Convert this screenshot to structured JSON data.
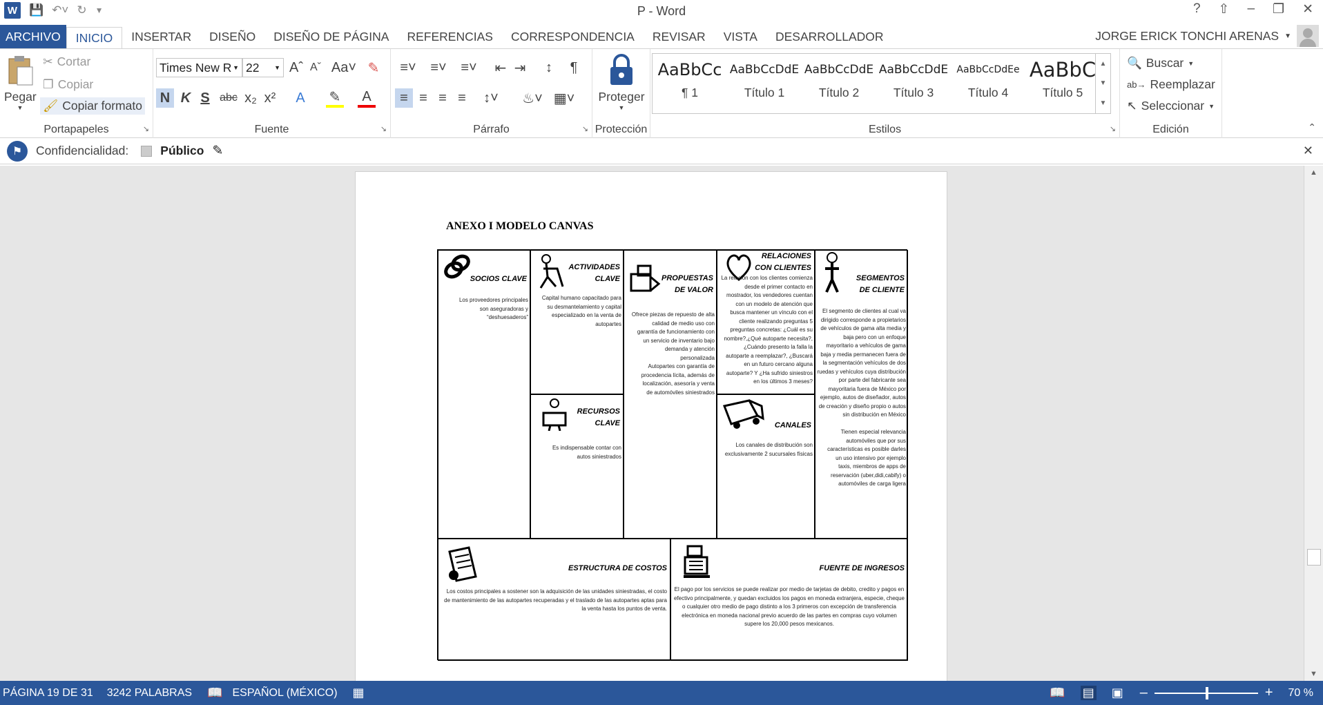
{
  "window": {
    "title": "P - Word"
  },
  "tabs": [
    {
      "label": "ARCHIVO"
    },
    {
      "label": "INICIO"
    },
    {
      "label": "INSERTAR"
    },
    {
      "label": "DISEÑO"
    },
    {
      "label": "DISEÑO DE PÁGINA"
    },
    {
      "label": "REFERENCIAS"
    },
    {
      "label": "CORRESPONDENCIA"
    },
    {
      "label": "REVISAR"
    },
    {
      "label": "VISTA"
    },
    {
      "label": "DESARROLLADOR"
    }
  ],
  "user": {
    "name": "JORGE ERICK TONCHI ARENAS"
  },
  "ribbon": {
    "clipboard": {
      "paste": "Pegar",
      "cut": "Cortar",
      "copy": "Copiar",
      "format_painter": "Copiar formato",
      "label": "Portapapeles"
    },
    "font": {
      "name": "Times New R",
      "size": "22",
      "label": "Fuente",
      "bold": "N",
      "italic": "K",
      "underline": "S",
      "strike": "abc"
    },
    "paragraph": {
      "label": "Párrafo"
    },
    "protection": {
      "protect": "Proteger",
      "label": "Protección"
    },
    "styles": {
      "label": "Estilos",
      "items": [
        {
          "preview": "AaBbCc",
          "name": "¶ 1"
        },
        {
          "preview": "AaBbCcDdE",
          "name": "Título 1"
        },
        {
          "preview": "AaBbCcDdE",
          "name": "Título 2"
        },
        {
          "preview": "AaBbCcDdE",
          "name": "Título 3"
        },
        {
          "preview": "AaBbCcDdEe",
          "name": "Título 4"
        },
        {
          "preview": "AaBbC",
          "name": "Título 5"
        }
      ]
    },
    "editing": {
      "find": "Buscar",
      "replace": "Reemplazar",
      "select": "Seleccionar",
      "label": "Edición"
    }
  },
  "infobar": {
    "label": "Confidencialidad:",
    "value": "Público"
  },
  "document": {
    "heading": "ANEXO I MODELO CANVAS",
    "canvas": {
      "socios": {
        "title1": "SOCIOS CLAVE",
        "text": "Los proveedores principales son aseguradoras y “deshuesaderos”"
      },
      "actividades": {
        "title1": "ACTIVIDADES",
        "title2": "CLAVE",
        "text": "Capital humano capacitado  para su desmantelamiento y capital especializado en la venta de autopartes"
      },
      "recursos": {
        "title1": "RECURSOS",
        "title2": "CLAVE",
        "text": "Es indispensable contar con autos siniestrados"
      },
      "propuestas": {
        "title1": "PROPUESTAS",
        "title2": "DE VALOR",
        "text1": "Ofrece piezas de repuesto de alta calidad de medio uso con garantía de funcionamiento con un servicio de inventario bajo demanda y atención personalizada",
        "text2": "Autopartes con garantía de procedencia lícita, además de localización, asesoría y venta de automóviles siniestrados"
      },
      "relaciones": {
        "title1": "RELACIONES",
        "title2": "CON CLIENTES",
        "text": "La relación con los clientes comienza desde el primer contacto en mostrador, los vendedores cuentan con un modelo de atención que busca mantener un vínculo con el cliente realizando preguntas 5 preguntas concretas: ¿Cuál es su nombre?,¿Qué autoparte necesita?, ¿Cuándo presento la falla la autoparte a reemplazar?, ¿Buscará en un futuro cercano alguna autoparte? Y ¿Ha sufrido siniestros en los últimos 3 meses?"
      },
      "canales": {
        "title1": "CANALES",
        "text": "Los canales de distribución son exclusivamente 2 sucursales físicas"
      },
      "segmentos": {
        "title1": "SEGMENTOS",
        "title2": "DE CLIENTE",
        "text1": "El segmento de clientes al cual va dirigido corresponde a propietarios de vehículos de gama alta media y baja pero con un enfoque mayoritario a vehículos de gama baja y media permanecen fuera de la segmentación vehículos de dos ruedas y vehículos cuya distribución por parte del fabricante sea mayoritaria fuera de México por ejemplo, autos de diseñador, autos de creación y diseño propio o autos sin distribución en México",
        "text2": "Tienen especial relevancia automóviles que por sus características es posible darles un uso intensivo por ejemplo taxis, miembros de apps de reservación (uber,didi,cabify) o automóviles de carga ligera"
      },
      "costos": {
        "title1": "ESTRUCTURA DE COSTOS",
        "text": "Los costos principales a sostener son la adquisición de las unidades siniestradas, el costo de mantenimiento de las autopartes recuperadas y el traslado de las autopartes aptas para la venta hasta los puntos de venta."
      },
      "ingresos": {
        "title1": "FUENTE DE INGRESOS",
        "text": "El pago por los servicios se puede realizar por medio de tarjetas de debito, credito y pagos en efectivo principalmente,  y quedan excluidos los pagos en moneda extranjera, especie, cheque o cualquier otro medio de pago distinto a los 3 primeros con excepción de transferencia electrónica en moneda nacional previo acuerdo de las partes en compras cuyo volumen supere los 20,000 pesos mexicanos."
      }
    }
  },
  "status": {
    "page": "PÁGINA 19 DE 31",
    "words": "3242 PALABRAS",
    "language": "ESPAÑOL (MÉXICO)",
    "zoom": "70 %"
  },
  "colors": {
    "accent": "#2b579a"
  }
}
